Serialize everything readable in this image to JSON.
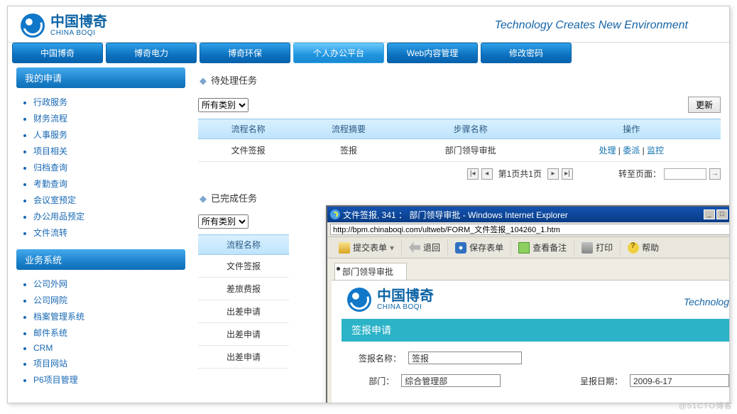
{
  "brand": {
    "cn": "中国博奇",
    "en": "CHINA BOQI",
    "slogan": "Technology Creates New Environment"
  },
  "nav": {
    "boqi": "中国博奇",
    "elec": "博奇电力",
    "env": "博奇环保",
    "personal": "个人办公平台",
    "web": "Web内容管理",
    "pwd": "修改密码"
  },
  "sidebar": {
    "myreq_title": "我的申请",
    "myreq": {
      "admin": "行政服务",
      "finance": "财务流程",
      "hr": "人事服务",
      "project": "项目相关",
      "archive": "归档查询",
      "attend": "考勤查询",
      "meeting": "会议室预定",
      "supply": "办公用品预定",
      "docflow": "文件流转"
    },
    "biz_title": "业务系统",
    "biz": {
      "extnet": "公司外网",
      "intranet": "公司网院",
      "archivesys": "档案管理系统",
      "mail": "邮件系统",
      "crm": "CRM",
      "projsite": "项目网站",
      "p6": "P6项目管理"
    }
  },
  "pending": {
    "title": "待处理任务",
    "select_label": "所有类别",
    "update_btn": "更新",
    "cols": {
      "name": "流程名称",
      "summary": "流程摘要",
      "step": "步骤名称",
      "op": "操作"
    },
    "row": {
      "name": "文件签报",
      "summary": "签报",
      "step": "部门领导审批",
      "op_handle": "处理",
      "op_delegate": "委派",
      "op_monitor": "监控"
    },
    "pager": {
      "text": "第1页共1页",
      "goto_lbl": "转至页面：",
      "go_arrow": "→"
    }
  },
  "done": {
    "title": "已完成任务",
    "select_label": "所有类别",
    "col_name": "流程名称",
    "rows": {
      "r1": "文件签报",
      "r2": "差旅费报",
      "r3": "出差申请",
      "r4": "出差申请",
      "r5": "出差申请"
    }
  },
  "popup": {
    "title": "文件签报, 341 ： 部门领导审批 - Windows Internet Explorer",
    "url": "http://bpm.chinaboqi.com/ultweb/FORM_文件签报_104260_1.htm",
    "tb": {
      "submit": "提交表单",
      "back": "退回",
      "save": "保存表单",
      "notes": "查看备注",
      "print": "打印",
      "help": "帮助"
    },
    "tab": "部门领导审批",
    "slogan2": "Technolog",
    "bar": "签报申请",
    "form": {
      "name_lbl": "签报名称：",
      "name_val": "签报",
      "dept_lbl": "部门：",
      "dept_val": "综合管理部",
      "date_lbl": "呈报日期：",
      "date_val": "2009-6-17"
    }
  },
  "watermark": "@51CTO博客"
}
